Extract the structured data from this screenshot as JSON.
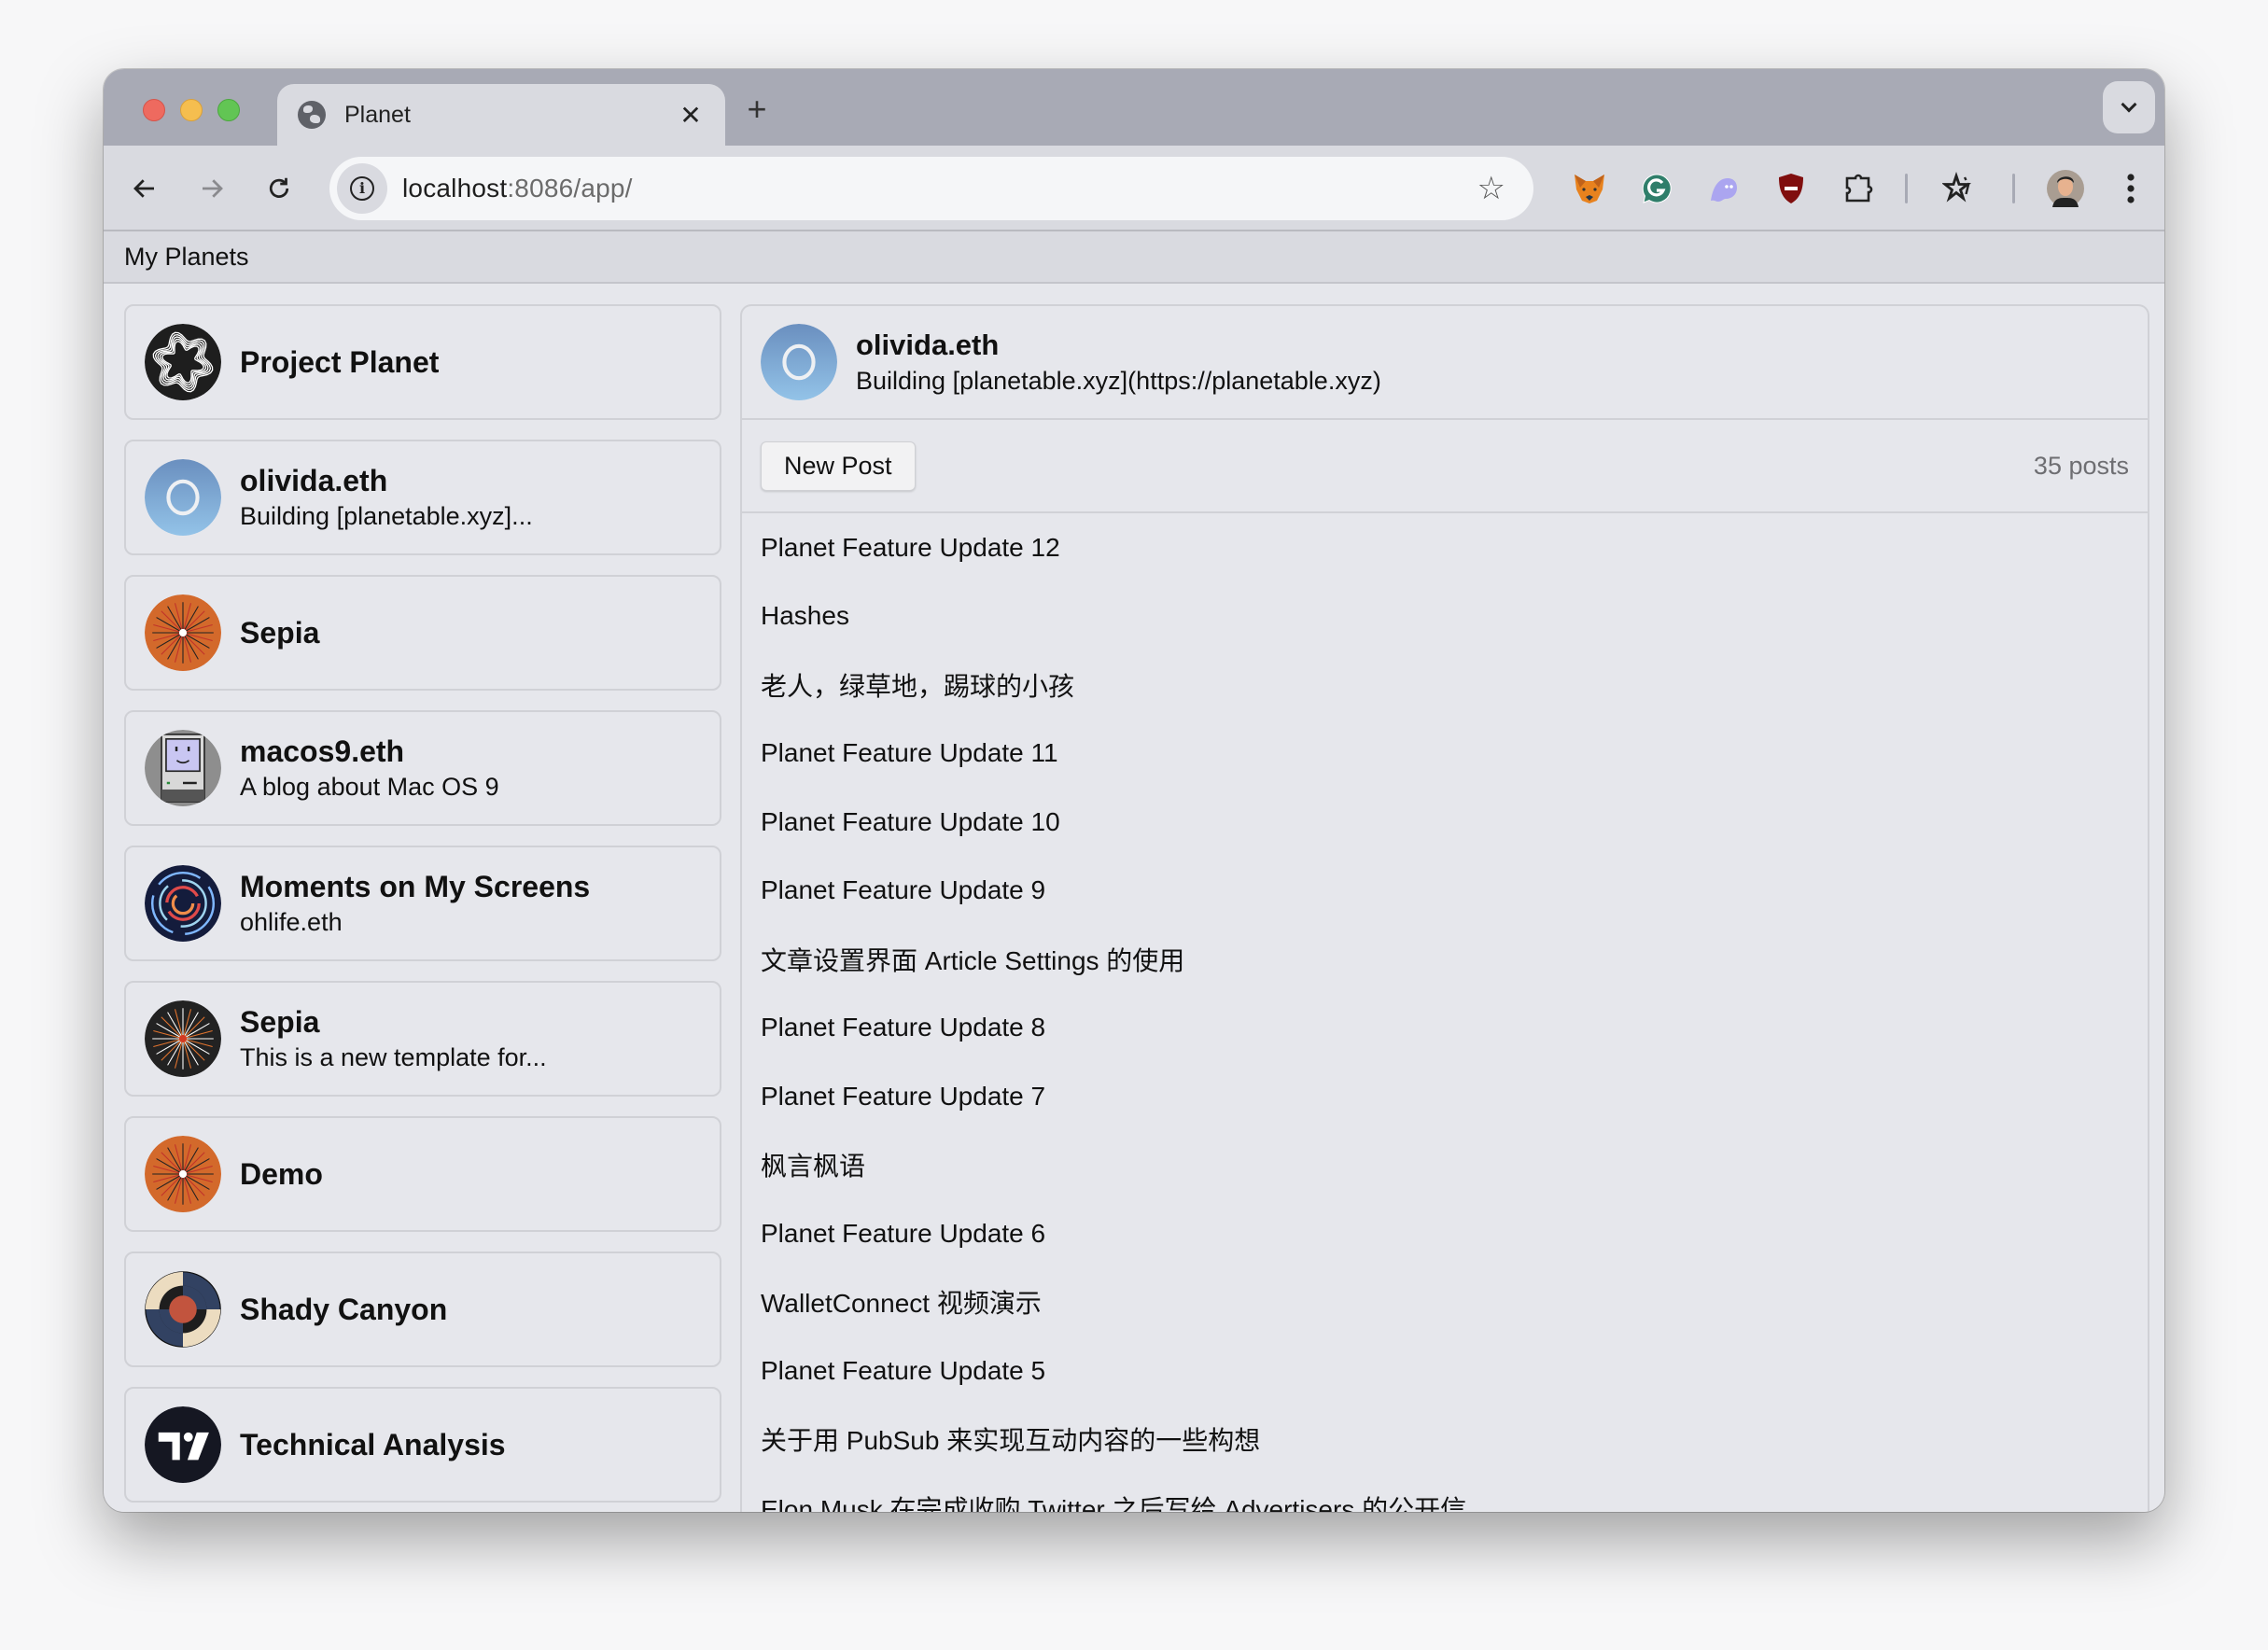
{
  "browser": {
    "tab": {
      "title": "Planet",
      "icon": "globe-icon"
    },
    "new_tab_label": "+",
    "url_host": "localhost",
    "url_rest": ":8086/app/",
    "extensions": [
      "metamask-fox-icon",
      "grammarly-icon",
      "phantom-ghost-icon",
      "ublock-shield-icon",
      "extensions-puzzle-icon"
    ],
    "colors": {
      "tabstrip": "#a8aab5",
      "toolbar": "#d9dae0"
    }
  },
  "app": {
    "title": "My Planets"
  },
  "planets": [
    {
      "name": "Project Planet",
      "subtitle": "",
      "avatar": "project-planet"
    },
    {
      "name": "olivida.eth",
      "subtitle": "Building [planetable.xyz]...",
      "avatar": "olivida"
    },
    {
      "name": "Sepia",
      "subtitle": "",
      "avatar": "sepia-orange"
    },
    {
      "name": "macos9.eth",
      "subtitle": "A blog about Mac OS 9",
      "avatar": "macos9"
    },
    {
      "name": "Moments on My Screens",
      "subtitle": "ohlife.eth",
      "avatar": "moments"
    },
    {
      "name": "Sepia",
      "subtitle": "This is a new template for...",
      "avatar": "sepia-dark"
    },
    {
      "name": "Demo",
      "subtitle": "",
      "avatar": "sepia-orange"
    },
    {
      "name": "Shady Canyon",
      "subtitle": "",
      "avatar": "shady-canyon"
    },
    {
      "name": "Technical Analysis",
      "subtitle": "",
      "avatar": "tradingview"
    }
  ],
  "selected_planet": {
    "name": "olivida.eth",
    "description": "Building [planetable.xyz](https://planetable.xyz)",
    "new_post_label": "New Post",
    "post_count": "35 posts",
    "posts": [
      "Planet Feature Update 12",
      "Hashes",
      "老人，绿草地，踢球的小孩",
      "Planet Feature Update 11",
      "Planet Feature Update 10",
      "Planet Feature Update 9",
      "文章设置界面 Article Settings 的使用",
      "Planet Feature Update 8",
      "Planet Feature Update 7",
      "枫言枫语",
      "Planet Feature Update 6",
      "WalletConnect 视频演示",
      "Planet Feature Update 5",
      "关于用 PubSub 来实现互动内容的一些构想",
      "Elon Musk 在完成收购 Twitter 之后写给 Advertisers 的公开信"
    ]
  }
}
